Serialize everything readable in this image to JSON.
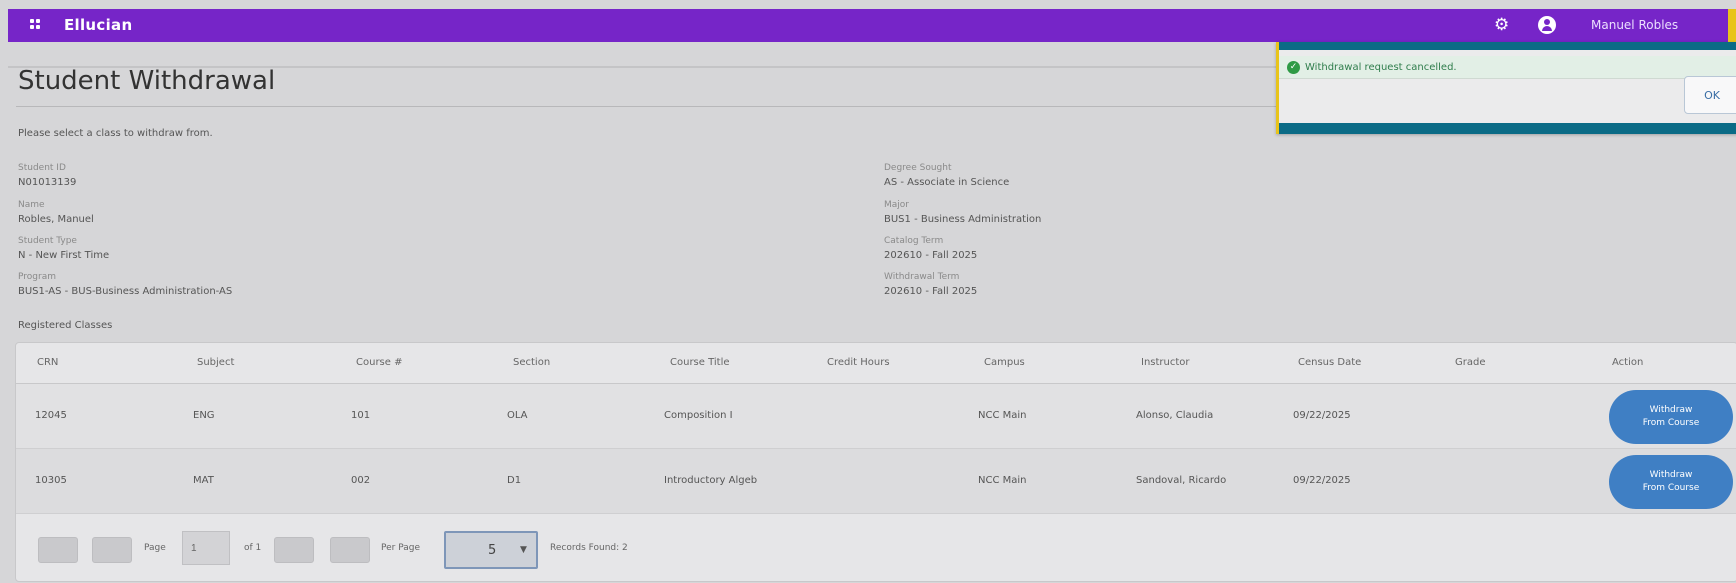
{
  "header": {
    "app_name": "Ellucian",
    "user_name": "Manuel Robles",
    "accent_color": "#7625c8"
  },
  "page": {
    "title": "Student Withdrawal",
    "instruction": "Please select a class to withdraw from."
  },
  "student": {
    "student_id_label": "Student ID",
    "student_id": "N01013139",
    "name_label": "Name",
    "name": "Robles, Manuel",
    "student_type_label": "Student Type",
    "student_type": "N - New First Time",
    "program_label": "Program",
    "program": "BUS1-AS - BUS-Business Administration-AS",
    "degree_label": "Degree Sought",
    "degree": "AS - Associate in Science",
    "major_label": "Major",
    "major": "BUS1 - Business Administration",
    "catalog_term_label": "Catalog Term",
    "catalog_term": "202610 - Fall 2025",
    "withdrawal_term_label": "Withdrawal Term",
    "withdrawal_term": "202610 - Fall 2025"
  },
  "classes": {
    "section_label": "Registered Classes",
    "columns": [
      "CRN",
      "Subject",
      "Course #",
      "Section",
      "Course Title",
      "Credit Hours",
      "Campus",
      "Instructor",
      "Census Date",
      "Grade",
      "Action"
    ],
    "rows": [
      {
        "crn": "12045",
        "subject": "ENG",
        "course": "101",
        "section": "OLA",
        "title": "Composition I",
        "credit_hours": "",
        "campus": "NCC Main",
        "instructor": "Alonso, Claudia",
        "census_date": "09/22/2025",
        "grade": "",
        "action": "Withdraw From Course"
      },
      {
        "crn": "10305",
        "subject": "MAT",
        "course": "002",
        "section": "D1",
        "title": "Introductory Algeb",
        "credit_hours": "",
        "campus": "NCC Main",
        "instructor": "Sandoval, Ricardo",
        "census_date": "09/22/2025",
        "grade": "",
        "action": "Withdraw From Course"
      }
    ]
  },
  "pagination": {
    "page_label": "Page",
    "page_value": "1",
    "of_label": "of 1",
    "per_page_label": "Per Page",
    "per_page_value": "5",
    "records_found": "Records Found: 2"
  },
  "toast": {
    "message": "Withdrawal request cancelled.",
    "ok_label": "OK",
    "status_color": "#2e9a45"
  }
}
